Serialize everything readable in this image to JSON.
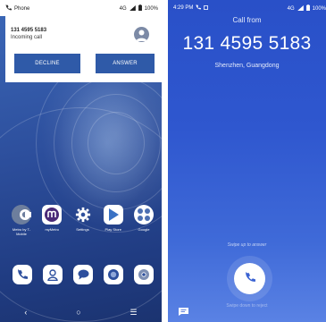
{
  "left_screen": {
    "status_bar": {
      "carrier": "Phone",
      "signal": "4G",
      "battery": "100%"
    },
    "notification": {
      "caller_number": "131 4595 5183",
      "subtitle": "Incoming call",
      "decline_label": "DECLINE",
      "answer_label": "ANSWER"
    },
    "apps": [
      {
        "label": "Metro by T-Mobile",
        "icon": "metro-icon"
      },
      {
        "label": "myMetro",
        "icon": "mymetro-icon"
      },
      {
        "label": "Settings",
        "icon": "gear-icon"
      },
      {
        "label": "Play Store",
        "icon": "play-store-icon"
      },
      {
        "label": "Google",
        "icon": "google-folder-icon"
      }
    ],
    "dock": [
      {
        "icon": "phone-icon"
      },
      {
        "icon": "contacts-icon"
      },
      {
        "icon": "messages-icon"
      },
      {
        "icon": "camera-icon"
      },
      {
        "icon": "chrome-icon"
      }
    ],
    "nav": {
      "back": "‹",
      "home": "○",
      "recents": "☰"
    }
  },
  "right_screen": {
    "status_bar": {
      "time": "4:29 PM",
      "signal": "4G",
      "battery": "100%"
    },
    "call_from": "Call from",
    "phone_number": "131 4595 5183",
    "location": "Shenzhen, Guangdong",
    "swipe_up": "Swipe up to answer",
    "swipe_down": "Swipe down to reject"
  },
  "colors": {
    "accent_blue": "#2f5aa8",
    "incall_bg": "#2f57cf",
    "wallpaper": "#2d4f9d"
  }
}
